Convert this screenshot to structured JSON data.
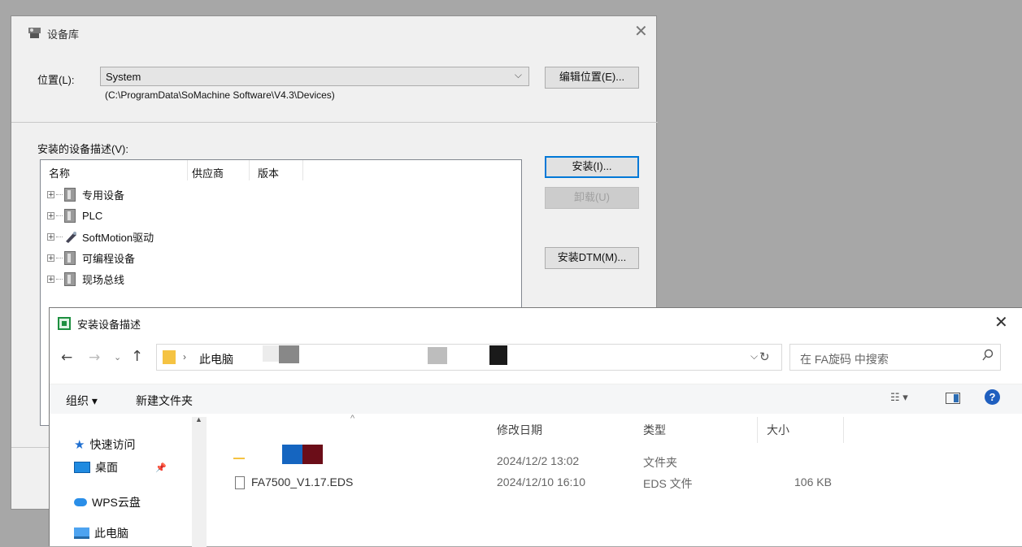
{
  "device_library": {
    "title": "设备库",
    "location_label": "位置(L):",
    "location_value": "System",
    "location_path": "(C:\\ProgramData\\SoMachine Software\\V4.3\\Devices)",
    "edit_location_button": "编辑位置(E)...",
    "installed_label": "安装的设备描述(V):",
    "columns": [
      "名称",
      "供应商",
      "版本"
    ],
    "tree_items": [
      {
        "label": "专用设备",
        "icon": "device-icon"
      },
      {
        "label": "PLC",
        "icon": "device-icon"
      },
      {
        "label": "SoftMotion驱动",
        "icon": "drive-icon"
      },
      {
        "label": "可编程设备",
        "icon": "device-icon"
      },
      {
        "label": "现场总线",
        "icon": "device-icon"
      }
    ],
    "install_button": "安装(I)...",
    "uninstall_button": "卸载(U)",
    "install_dtm_button": "安装DTM(M)..."
  },
  "install_dialog": {
    "title": "安装设备描述",
    "breadcrumb_root": "此电脑",
    "search_placeholder": "在 FA旋码 中搜索",
    "organize_label": "组织 ▾",
    "new_folder_label": "新建文件夹",
    "sidebar": [
      {
        "label": "快速访问",
        "icon": "star-icon"
      },
      {
        "label": "桌面",
        "icon": "desktop-icon"
      },
      {
        "label": "WPS云盘",
        "icon": "cloud-icon"
      },
      {
        "label": "此电脑",
        "icon": "computer-icon"
      }
    ],
    "columns": {
      "modified": "修改日期",
      "type": "类型",
      "size": "大小"
    },
    "files": [
      {
        "name": "",
        "modified": "2024/12/2 13:02",
        "type": "文件夹",
        "size": ""
      },
      {
        "name": "FA7500_V1.17.EDS",
        "modified": "2024/12/10 16:10",
        "type": "EDS 文件",
        "size": "106 KB"
      }
    ]
  },
  "colors": {
    "accent": "#0078d7",
    "folder": "#f5c342"
  }
}
